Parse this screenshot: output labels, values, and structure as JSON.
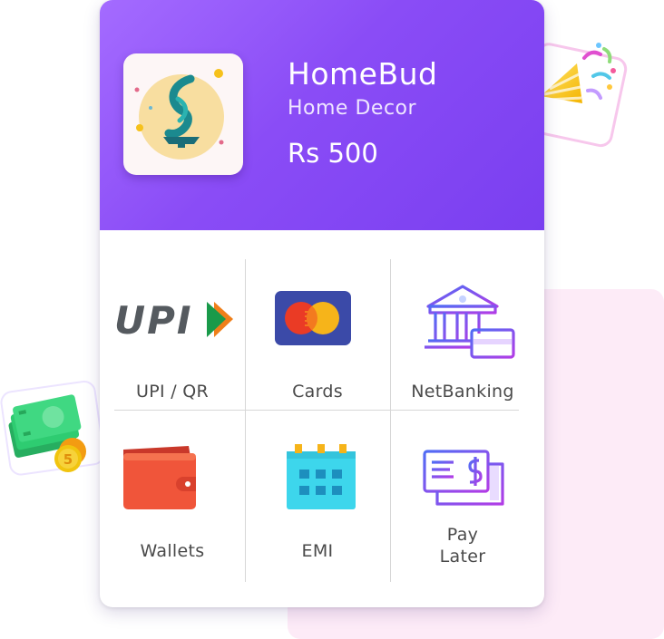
{
  "merchant": {
    "name": "HomeBud",
    "category": "Home Decor",
    "amount": "Rs 500",
    "logo_icon": "homebud-logo-icon"
  },
  "payment_methods": [
    {
      "label": "UPI / QR",
      "icon": "upi-logo-icon"
    },
    {
      "label": "Cards",
      "icon": "card-icon"
    },
    {
      "label": "NetBanking",
      "icon": "bank-icon"
    },
    {
      "label": "Wallets",
      "icon": "wallet-icon"
    },
    {
      "label": "EMI",
      "icon": "calendar-icon"
    },
    {
      "label_line1": "Pay",
      "label_line2": "Later",
      "icon": "bill-icon"
    }
  ],
  "upi_logo_text": "UPI",
  "decorations": [
    "party-popper-icon",
    "cash-coin-icon"
  ],
  "colors": {
    "header_gradient_start": "#a46bff",
    "header_gradient_end": "#7a3ff0",
    "accent_purple": "#7c3aed",
    "card_blue": "#3b4aa8",
    "wallet_red": "#f0553a",
    "emi_cyan": "#3dd6ec",
    "background_pink": "#fdebf7"
  }
}
